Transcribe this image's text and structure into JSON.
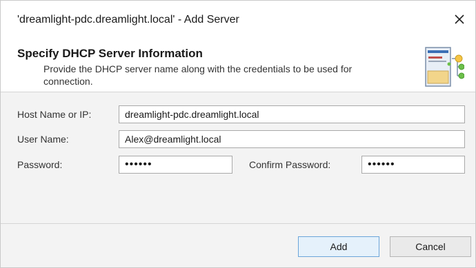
{
  "window": {
    "title": "'dreamlight-pdc.dreamlight.local' - Add Server",
    "close_icon": "close-icon"
  },
  "header": {
    "title": "Specify DHCP Server Information",
    "description": "Provide the DHCP server name along with the credentials to be used for connection.",
    "icon": "dhcp-server-icon"
  },
  "form": {
    "host": {
      "label": "Host Name or IP:",
      "value": "dreamlight-pdc.dreamlight.local"
    },
    "user": {
      "label": "User Name:",
      "value": "Alex@dreamlight.local"
    },
    "password": {
      "label": "Password:",
      "value": "••••••"
    },
    "confirm_password": {
      "label": "Confirm Password:",
      "value": "••••••"
    }
  },
  "buttons": {
    "add": "Add",
    "cancel": "Cancel"
  },
  "colors": {
    "form_background": "#f3f3f3",
    "primary_button_border": "#6ba5d9",
    "primary_button_fill": "#e5f1fb"
  }
}
